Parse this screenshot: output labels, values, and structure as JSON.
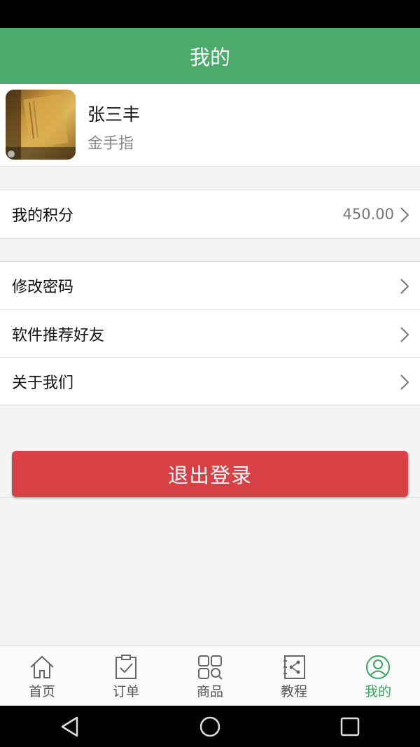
{
  "header": {
    "title": "我的"
  },
  "profile": {
    "name": "张三丰",
    "subtitle": "金手指"
  },
  "points": {
    "label": "我的积分",
    "value": "450.00"
  },
  "menu": [
    {
      "label": "修改密码"
    },
    {
      "label": "软件推荐好友"
    },
    {
      "label": "关于我们"
    }
  ],
  "logout_label": "退出登录",
  "tabs": [
    {
      "label": "首页",
      "icon": "home-icon"
    },
    {
      "label": "订单",
      "icon": "order-icon"
    },
    {
      "label": "商品",
      "icon": "goods-icon"
    },
    {
      "label": "教程",
      "icon": "tutorial-icon"
    },
    {
      "label": "我的",
      "icon": "user-icon",
      "active": true
    }
  ],
  "colors": {
    "header": "#4aab6d",
    "active_tab": "#3aa35d",
    "logout": "#d74045"
  }
}
